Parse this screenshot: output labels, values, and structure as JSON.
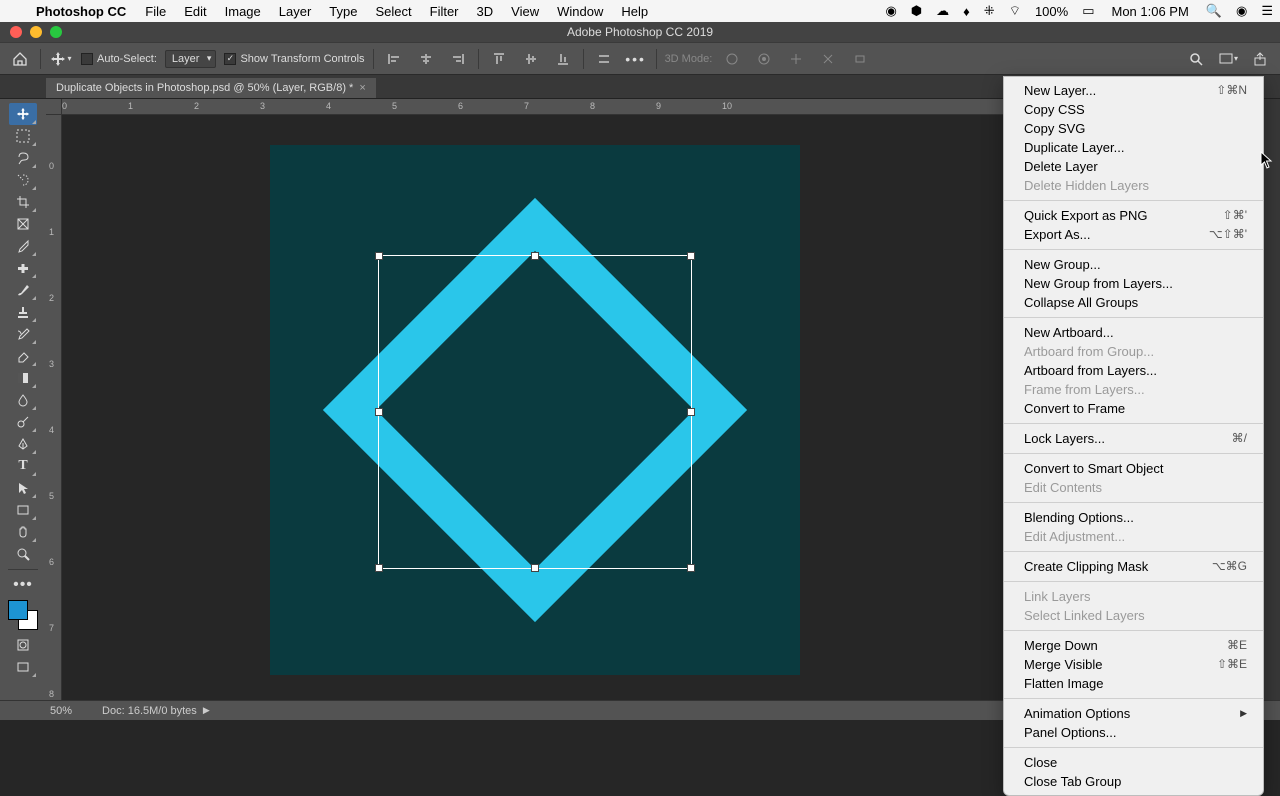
{
  "macmenu": {
    "app": "Photoshop CC",
    "items": [
      "File",
      "Edit",
      "Image",
      "Layer",
      "Type",
      "Select",
      "Filter",
      "3D",
      "View",
      "Window",
      "Help"
    ],
    "battery": "100%",
    "clock": "Mon 1:06 PM"
  },
  "titlebar": {
    "title": "Adobe Photoshop CC 2019"
  },
  "options": {
    "auto_select": "Auto-Select:",
    "layer_sel": "Layer",
    "show_transform": "Show Transform Controls",
    "mode3d": "3D Mode:"
  },
  "tab": {
    "label": "Duplicate Objects in Photoshop.psd @ 50% (Layer, RGB/8) *"
  },
  "ruler_h": [
    "0",
    "1",
    "2",
    "3",
    "4",
    "5",
    "6",
    "7",
    "8",
    "9",
    "10"
  ],
  "ruler_v": [
    "0",
    "1",
    "2",
    "3",
    "4",
    "5",
    "6",
    "7",
    "8"
  ],
  "ctx": {
    "new_layer": "New Layer...",
    "new_layer_sc": "⇧⌘N",
    "copy_css": "Copy CSS",
    "copy_svg": "Copy SVG",
    "dup_layer": "Duplicate Layer...",
    "del_layer": "Delete Layer",
    "del_hidden": "Delete Hidden Layers",
    "quick_export": "Quick Export as PNG",
    "quick_export_sc": "⇧⌘'",
    "export_as": "Export As...",
    "export_as_sc": "⌥⇧⌘'",
    "new_group": "New Group...",
    "new_group_layers": "New Group from Layers...",
    "collapse_groups": "Collapse All Groups",
    "new_artboard": "New Artboard...",
    "artboard_group": "Artboard from Group...",
    "artboard_layers": "Artboard from Layers...",
    "frame_layers": "Frame from Layers...",
    "convert_frame": "Convert to Frame",
    "lock_layers": "Lock Layers...",
    "lock_layers_sc": "⌘/",
    "convert_smart": "Convert to Smart Object",
    "edit_contents": "Edit Contents",
    "blending": "Blending Options...",
    "edit_adj": "Edit Adjustment...",
    "clip_mask": "Create Clipping Mask",
    "clip_mask_sc": "⌥⌘G",
    "link_layers": "Link Layers",
    "select_linked": "Select Linked Layers",
    "merge_down": "Merge Down",
    "merge_down_sc": "⌘E",
    "merge_visible": "Merge Visible",
    "merge_visible_sc": "⇧⌘E",
    "flatten": "Flatten Image",
    "anim_options": "Animation Options",
    "panel_options": "Panel Options...",
    "close": "Close",
    "close_tab_group": "Close Tab Group"
  },
  "status": {
    "zoom": "50%",
    "doc": "Doc: 16.5M/0 bytes"
  }
}
